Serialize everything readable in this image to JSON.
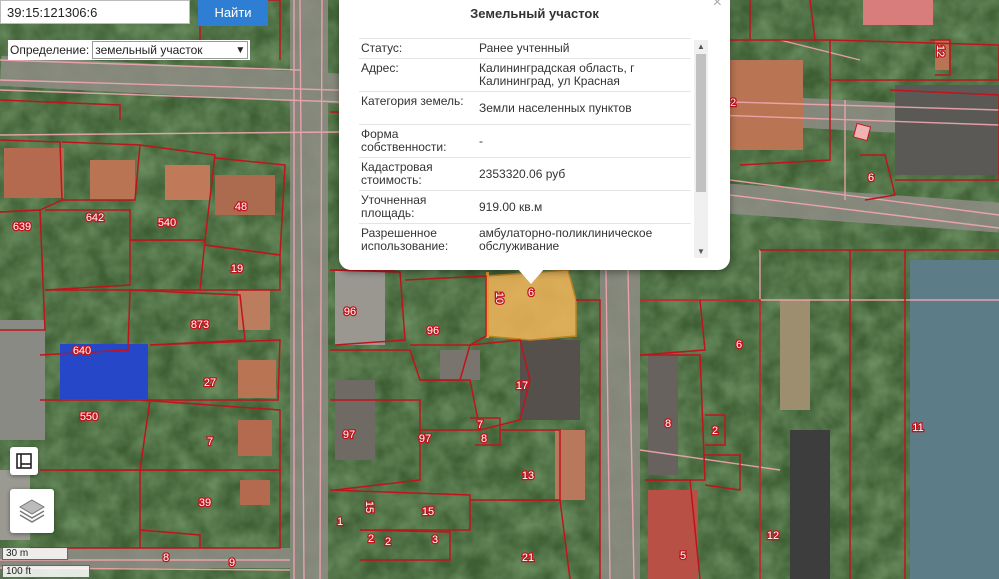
{
  "search": {
    "value": "39:15:121306:6",
    "button": "Найти"
  },
  "definition": {
    "label": "Определение:",
    "selected": "земельный участок"
  },
  "popup": {
    "title": "Земельный участок",
    "rows": [
      {
        "key": "Статус:",
        "value": "Ранее учтенный"
      },
      {
        "key": "Адрес:",
        "value": "Калининградская область, г Калининград, ул Красная"
      },
      {
        "key": "Категория земель:",
        "value": "Земли населенных пунктов"
      },
      {
        "key": "Форма собственности:",
        "value": "-"
      },
      {
        "key": "Кадастровая стоимость:",
        "value": "2353320.06 руб"
      },
      {
        "key": "Уточненная площадь:",
        "value": "919.00 кв.м"
      },
      {
        "key": "Разрешенное использование:",
        "value": "амбулаторно-поликлиническое обслуживание"
      }
    ]
  },
  "scale": {
    "metric": "30 m",
    "imperial": "100 ft"
  },
  "map_labels": [
    "639",
    "642",
    "540",
    "48",
    "19",
    "873",
    "640",
    "27",
    "550",
    "7",
    "39",
    "8",
    "9",
    "96",
    "96",
    "97",
    "97",
    "17",
    "7",
    "8",
    "13",
    "1",
    "15",
    "2",
    "2",
    "3",
    "21",
    "15",
    "10",
    "6",
    "6",
    "8",
    "2",
    "5",
    "12",
    "11",
    "12",
    "2",
    "6"
  ],
  "colors": {
    "parcel_line": "#c0141c",
    "selected_fill": "#f2b55a",
    "blue_roof": "#2647c8",
    "search_button": "#2e7fd3"
  }
}
